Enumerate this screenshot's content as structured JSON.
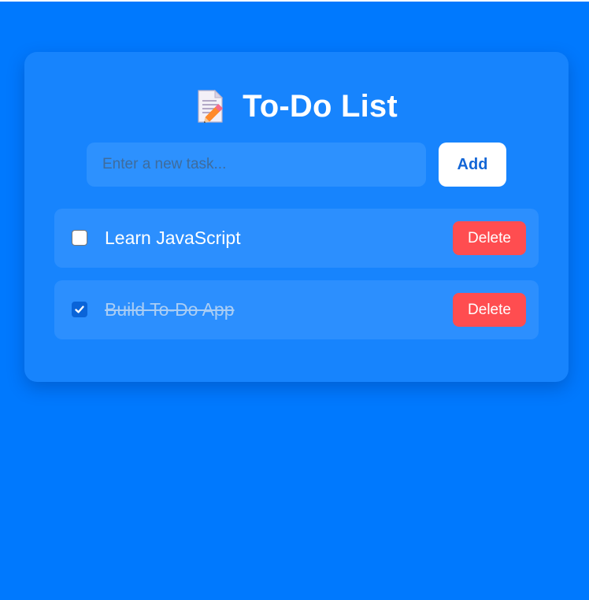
{
  "header": {
    "title": "To-Do List",
    "icon": "memo-icon"
  },
  "new_task": {
    "value": "",
    "placeholder": "Enter a new task...",
    "add_label": "Add"
  },
  "tasks": [
    {
      "label": "Learn JavaScript",
      "completed": false,
      "delete_label": "Delete"
    },
    {
      "label": "Build To-Do App",
      "completed": true,
      "delete_label": "Delete"
    }
  ],
  "colors": {
    "background": "#0079fe",
    "card": "#1784fd",
    "task_row": "#2c8ffe",
    "delete": "#ff4d50",
    "add_text": "#1366d6"
  }
}
